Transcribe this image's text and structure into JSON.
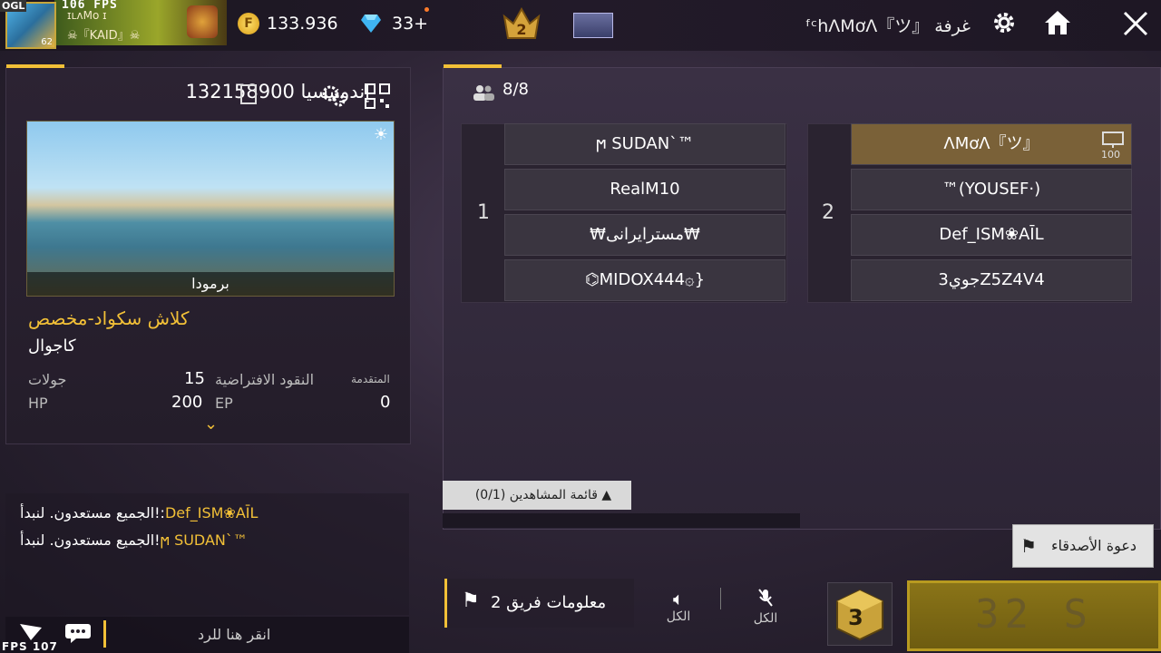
{
  "hud": {
    "ogl": "OGL",
    "fps_top": "106 FPS",
    "fps_bottom": "FPS 107",
    "avatar_level": "62"
  },
  "player": {
    "name_top": "ɪʟʌMᴏ ɪ",
    "name": "☠『KAID』☠"
  },
  "currency": {
    "gold": "133.936",
    "diamonds": "33+",
    "gold_icon": "F"
  },
  "room": {
    "title": "ᶠᶜhɅMơɅ『ツ』 غرفة"
  },
  "left_panel": {
    "room_id": "132158900 إندونيسيا",
    "map_name": "برمودا",
    "mode_title": "كلاش سكواد-مخصص",
    "mode_sub": "كاجوال",
    "stats": {
      "rounds_label": "جولات",
      "rounds_value": "15",
      "default_coins_label": "النقود الافتراضية",
      "advanced_label": "المتقدمة",
      "advanced_value": "0",
      "hp_label": "HP",
      "hp_value": "200",
      "ep_label": "EP"
    }
  },
  "chat": {
    "lines": [
      {
        "name": "Def_ISM❀AĪL",
        "text": "الجميع مستعدون. لنبدأ!:"
      },
      {
        "name": "ϻ   SUDAN`™",
        "text": "الجميع مستعدون. لنبدأ!"
      }
    ],
    "reply_placeholder": "انقر هنا للرد"
  },
  "teams": {
    "slots": "8/8",
    "team1": {
      "number": "1",
      "players": [
        "ϻ   SUDAN`™",
        "RealM10",
        "₩مسترايرانى₩",
        "⌬MIDOX444۞}"
      ]
    },
    "team2": {
      "number": "2",
      "host_badge": "100",
      "players": [
        "ɅMơɅ『ツ』",
        "™(YOUSEF·)",
        "Def_ISM❀AĪL",
        "جوي3Z5Z4V4"
      ]
    }
  },
  "spectators": {
    "label": "قائمة المشاهدين",
    "count": "(0/1)"
  },
  "buttons": {
    "invite_friends": "دعوة الأصدقاء",
    "team_info": "معلومات فريق 2",
    "speaker_all": "الكل",
    "mic_all": "الكل",
    "cube_number": "3",
    "start_timer": "32 S"
  },
  "colors": {
    "accent": "#f2c037",
    "host_slot": "#7a6138"
  }
}
